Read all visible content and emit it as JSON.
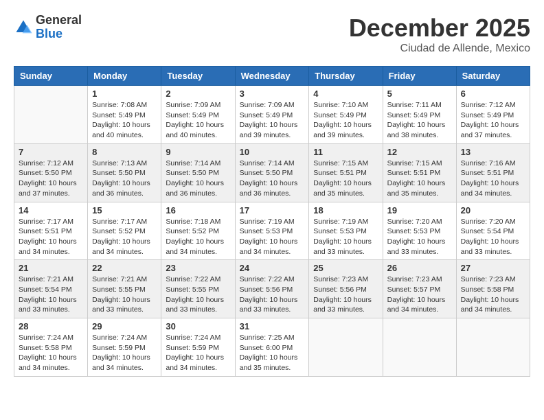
{
  "logo": {
    "general": "General",
    "blue": "Blue"
  },
  "title": "December 2025",
  "location": "Ciudad de Allende, Mexico",
  "days_header": [
    "Sunday",
    "Monday",
    "Tuesday",
    "Wednesday",
    "Thursday",
    "Friday",
    "Saturday"
  ],
  "weeks": [
    [
      {
        "num": "",
        "info": ""
      },
      {
        "num": "1",
        "info": "Sunrise: 7:08 AM\nSunset: 5:49 PM\nDaylight: 10 hours\nand 40 minutes."
      },
      {
        "num": "2",
        "info": "Sunrise: 7:09 AM\nSunset: 5:49 PM\nDaylight: 10 hours\nand 40 minutes."
      },
      {
        "num": "3",
        "info": "Sunrise: 7:09 AM\nSunset: 5:49 PM\nDaylight: 10 hours\nand 39 minutes."
      },
      {
        "num": "4",
        "info": "Sunrise: 7:10 AM\nSunset: 5:49 PM\nDaylight: 10 hours\nand 39 minutes."
      },
      {
        "num": "5",
        "info": "Sunrise: 7:11 AM\nSunset: 5:49 PM\nDaylight: 10 hours\nand 38 minutes."
      },
      {
        "num": "6",
        "info": "Sunrise: 7:12 AM\nSunset: 5:49 PM\nDaylight: 10 hours\nand 37 minutes."
      }
    ],
    [
      {
        "num": "7",
        "info": "Sunrise: 7:12 AM\nSunset: 5:50 PM\nDaylight: 10 hours\nand 37 minutes."
      },
      {
        "num": "8",
        "info": "Sunrise: 7:13 AM\nSunset: 5:50 PM\nDaylight: 10 hours\nand 36 minutes."
      },
      {
        "num": "9",
        "info": "Sunrise: 7:14 AM\nSunset: 5:50 PM\nDaylight: 10 hours\nand 36 minutes."
      },
      {
        "num": "10",
        "info": "Sunrise: 7:14 AM\nSunset: 5:50 PM\nDaylight: 10 hours\nand 36 minutes."
      },
      {
        "num": "11",
        "info": "Sunrise: 7:15 AM\nSunset: 5:51 PM\nDaylight: 10 hours\nand 35 minutes."
      },
      {
        "num": "12",
        "info": "Sunrise: 7:15 AM\nSunset: 5:51 PM\nDaylight: 10 hours\nand 35 minutes."
      },
      {
        "num": "13",
        "info": "Sunrise: 7:16 AM\nSunset: 5:51 PM\nDaylight: 10 hours\nand 34 minutes."
      }
    ],
    [
      {
        "num": "14",
        "info": "Sunrise: 7:17 AM\nSunset: 5:51 PM\nDaylight: 10 hours\nand 34 minutes."
      },
      {
        "num": "15",
        "info": "Sunrise: 7:17 AM\nSunset: 5:52 PM\nDaylight: 10 hours\nand 34 minutes."
      },
      {
        "num": "16",
        "info": "Sunrise: 7:18 AM\nSunset: 5:52 PM\nDaylight: 10 hours\nand 34 minutes."
      },
      {
        "num": "17",
        "info": "Sunrise: 7:19 AM\nSunset: 5:53 PM\nDaylight: 10 hours\nand 34 minutes."
      },
      {
        "num": "18",
        "info": "Sunrise: 7:19 AM\nSunset: 5:53 PM\nDaylight: 10 hours\nand 33 minutes."
      },
      {
        "num": "19",
        "info": "Sunrise: 7:20 AM\nSunset: 5:53 PM\nDaylight: 10 hours\nand 33 minutes."
      },
      {
        "num": "20",
        "info": "Sunrise: 7:20 AM\nSunset: 5:54 PM\nDaylight: 10 hours\nand 33 minutes."
      }
    ],
    [
      {
        "num": "21",
        "info": "Sunrise: 7:21 AM\nSunset: 5:54 PM\nDaylight: 10 hours\nand 33 minutes."
      },
      {
        "num": "22",
        "info": "Sunrise: 7:21 AM\nSunset: 5:55 PM\nDaylight: 10 hours\nand 33 minutes."
      },
      {
        "num": "23",
        "info": "Sunrise: 7:22 AM\nSunset: 5:55 PM\nDaylight: 10 hours\nand 33 minutes."
      },
      {
        "num": "24",
        "info": "Sunrise: 7:22 AM\nSunset: 5:56 PM\nDaylight: 10 hours\nand 33 minutes."
      },
      {
        "num": "25",
        "info": "Sunrise: 7:23 AM\nSunset: 5:56 PM\nDaylight: 10 hours\nand 33 minutes."
      },
      {
        "num": "26",
        "info": "Sunrise: 7:23 AM\nSunset: 5:57 PM\nDaylight: 10 hours\nand 34 minutes."
      },
      {
        "num": "27",
        "info": "Sunrise: 7:23 AM\nSunset: 5:58 PM\nDaylight: 10 hours\nand 34 minutes."
      }
    ],
    [
      {
        "num": "28",
        "info": "Sunrise: 7:24 AM\nSunset: 5:58 PM\nDaylight: 10 hours\nand 34 minutes."
      },
      {
        "num": "29",
        "info": "Sunrise: 7:24 AM\nSunset: 5:59 PM\nDaylight: 10 hours\nand 34 minutes."
      },
      {
        "num": "30",
        "info": "Sunrise: 7:24 AM\nSunset: 5:59 PM\nDaylight: 10 hours\nand 34 minutes."
      },
      {
        "num": "31",
        "info": "Sunrise: 7:25 AM\nSunset: 6:00 PM\nDaylight: 10 hours\nand 35 minutes."
      },
      {
        "num": "",
        "info": ""
      },
      {
        "num": "",
        "info": ""
      },
      {
        "num": "",
        "info": ""
      }
    ]
  ]
}
